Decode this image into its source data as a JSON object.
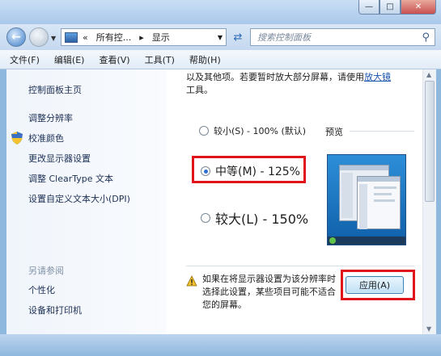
{
  "window": {
    "title": "",
    "controls": {
      "minimize": "—",
      "maximize": "□",
      "close": "✕"
    }
  },
  "address_bar": {
    "back_icon": "back-arrow-icon",
    "forward_icon": "forward-arrow-icon",
    "overflow": "«",
    "crumb_parent": "所有控...",
    "separator": "▸",
    "crumb_current": "显示",
    "search_placeholder": "搜索控制面板"
  },
  "menu": [
    "文件(F)",
    "编辑(E)",
    "查看(V)",
    "工具(T)",
    "帮助(H)"
  ],
  "sidebar": {
    "home": "控制面板主页",
    "tasks": [
      "调整分辨率",
      "校准颜色",
      "更改显示器设置",
      "调整 ClearType 文本",
      "设置自定义文本大小(DPI)"
    ],
    "see_also_heading": "另请参阅",
    "see_also": [
      "个性化",
      "设备和打印机"
    ]
  },
  "main": {
    "intro_line1": "以及其他项。若要暂时放大部分屏幕，请使用",
    "intro_link": "放大镜",
    "intro_line2": "工具。",
    "options": [
      {
        "label": "较小(S) - 100% (默认)",
        "checked": false
      },
      {
        "label": "中等(M) - 125%",
        "checked": true
      },
      {
        "label": "较大(L) - 150%",
        "checked": false
      }
    ],
    "preview_label": "预览",
    "warning_text": "如果在将显示器设置为该分辨率时选择此设置，某些项目可能不适合您的屏幕。",
    "apply_button": "应用(A)"
  },
  "colors": {
    "highlight": "#e0141b",
    "link": "#1a55b0",
    "accent": "#2b6fcf"
  }
}
